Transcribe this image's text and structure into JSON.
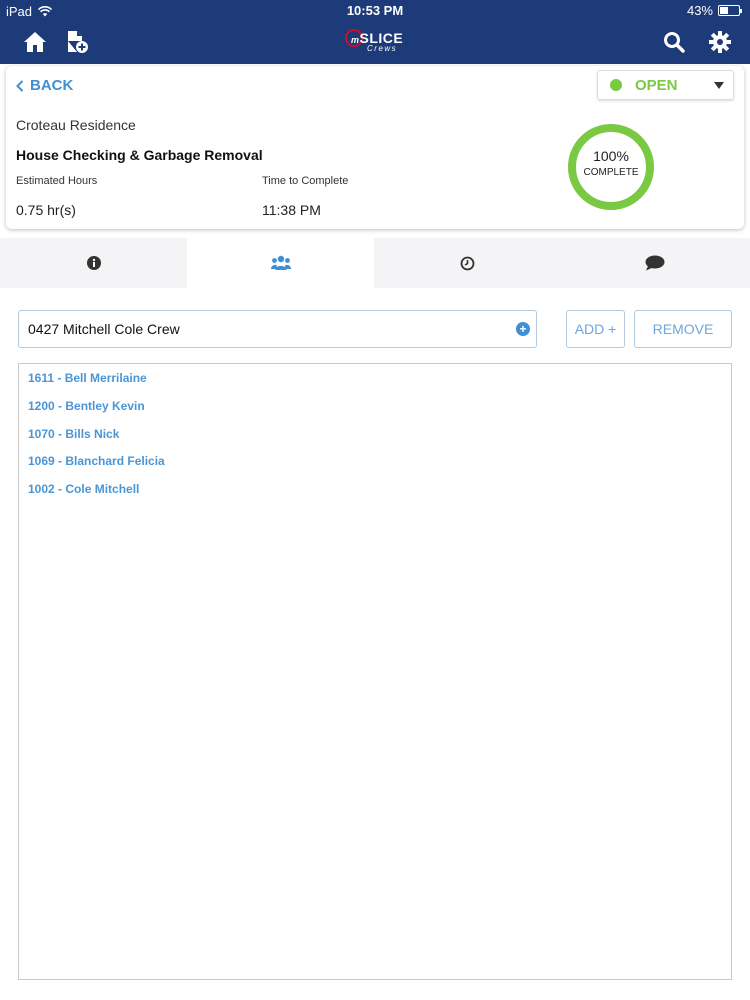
{
  "status_bar": {
    "device": "iPad",
    "time": "10:53 PM",
    "battery_text": "43%",
    "battery_level": 0.43
  },
  "nav": {
    "logo_main": "SLICE",
    "logo_prefix": "m",
    "logo_sub": "Crews"
  },
  "header": {
    "back_label": "BACK",
    "status": {
      "label": "OPEN",
      "color": "#7ac943"
    },
    "customer": "Croteau Residence",
    "job_title": "House Checking & Garbage Removal",
    "estimated_hours_label": "Estimated Hours",
    "estimated_hours_value": "0.75 hr(s)",
    "time_to_complete_label": "Time to Complete",
    "time_to_complete_value": "11:38 PM",
    "progress": {
      "percent_text": "100%",
      "caption": "COMPLETE",
      "fraction": 1.0,
      "color": "#7ac943"
    }
  },
  "tabs": [
    {
      "name": "info-icon",
      "active": false
    },
    {
      "name": "crew-users-icon",
      "active": true
    },
    {
      "name": "clock-icon",
      "active": false
    },
    {
      "name": "comment-icon",
      "active": false
    }
  ],
  "crew": {
    "selected": "0427 Mitchell Cole Crew",
    "add_label": "ADD +",
    "remove_label": "REMOVE",
    "members": [
      "1611 - Bell Merrilaine",
      "1200 - Bentley Kevin",
      "1070 - Bills Nick",
      "1069 - Blanchard Felicia",
      "1002 - Cole Mitchell"
    ]
  },
  "colors": {
    "nav_bg": "#1d3b78",
    "accent": "#3f8fd6",
    "status_green": "#7ac943"
  }
}
